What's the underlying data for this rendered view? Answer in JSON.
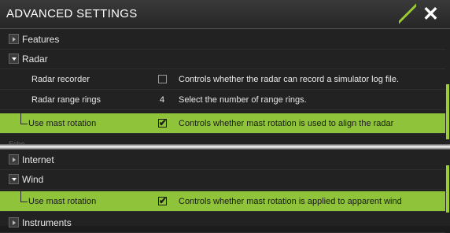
{
  "title": "ADVANCED SETTINGS",
  "close_icon": "close-icon",
  "top": {
    "features": "Features",
    "radar": "Radar",
    "radar_recorder": {
      "label": "Radar recorder",
      "desc": "Controls whether the radar can record a simulator log file.",
      "checked": false
    },
    "range_rings": {
      "label": "Radar range rings",
      "value": "4",
      "desc": "Select the number of range rings."
    },
    "mast_rotation": {
      "label": "Use mast rotation",
      "desc": "Controls whether mast rotation is used to align the radar",
      "checked": true
    },
    "echo_partial": "Echo"
  },
  "bottom": {
    "internet": "Internet",
    "wind": "Wind",
    "wind_mast": {
      "label": "Use mast rotation",
      "desc": "Controls whether mast rotation is applied to apparent wind",
      "checked": true
    },
    "instruments": "Instruments"
  },
  "accent_color": "#8fc43a"
}
